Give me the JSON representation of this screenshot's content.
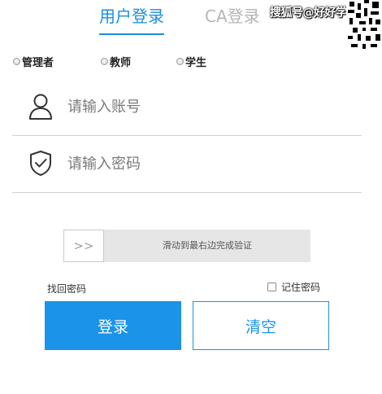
{
  "tabs": {
    "user_login": "用户登录",
    "ca_login": "CA登录"
  },
  "watermark": {
    "text": "搜狐号@好好学"
  },
  "roles": {
    "admin": "管理者",
    "teacher": "教师",
    "student": "学生"
  },
  "username": {
    "placeholder": "请输入账号",
    "value": "",
    "icon": "user-icon"
  },
  "password": {
    "placeholder": "请输入密码",
    "value": "",
    "icon": "shield-check-icon"
  },
  "captcha": {
    "handle_glyph": ">>",
    "hint": "滑动到最右边完成验证",
    "progress": 0
  },
  "links": {
    "forgot": "找回密码",
    "remember": "记住密码"
  },
  "buttons": {
    "login": "登录",
    "clear": "清空"
  },
  "colors": {
    "accent": "#1a93e8",
    "tab_active": "#1a8fdc",
    "tab_inactive": "#b5b5b5"
  }
}
